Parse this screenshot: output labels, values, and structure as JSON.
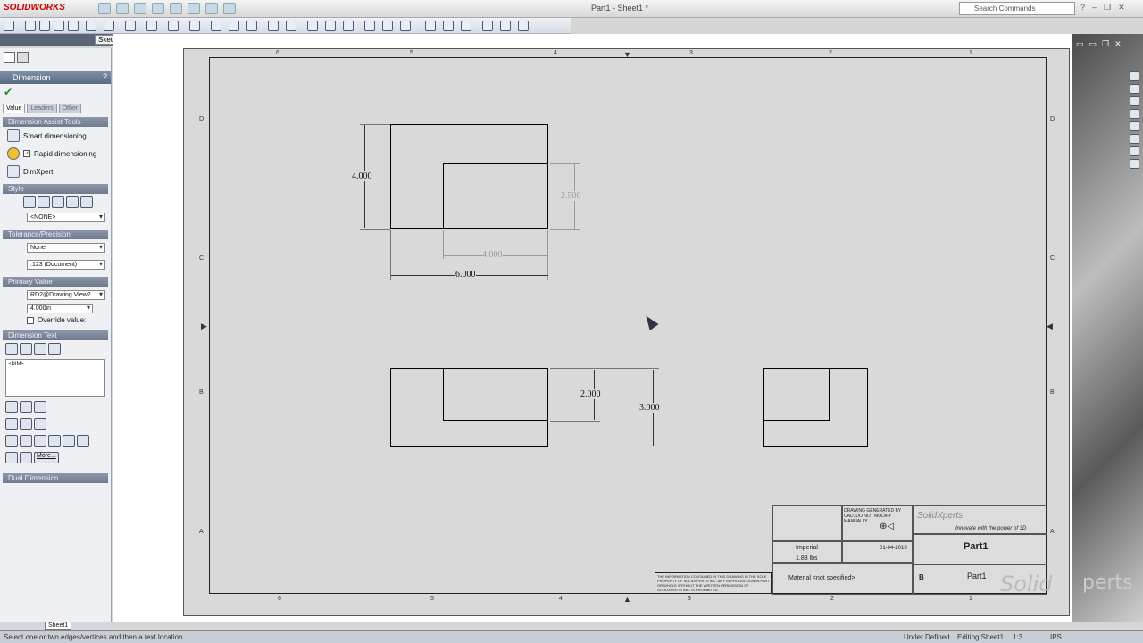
{
  "app": {
    "logo": "SOLIDWORKS",
    "doc_title": "Part1 - Sheet1 *"
  },
  "search": {
    "placeholder": "Search Commands"
  },
  "tabs": {
    "sketch": "Sketch"
  },
  "panel": {
    "title": "Dimension",
    "prop_tabs": [
      "Value",
      "Leaders",
      "Other"
    ],
    "dim_assist_head": "Dimension Assist Tools",
    "smart_dim": "Smart dimensioning",
    "rapid_dim": "Rapid dimensioning",
    "dimxpert": "DimXpert",
    "style_head": "Style",
    "style_value": "<NONE>",
    "tol_head": "Tolerance/Precision",
    "tol_none": "None",
    "tol_doc": ".123 (Document)",
    "primary_head": "Primary Value",
    "primary_ref": "RD2@Drawing View2",
    "primary_val": "4.000in",
    "override": "Override value:",
    "dimtext_head": "Dimension Text",
    "dimtext_content": "<DIM>",
    "more": "More...",
    "dual_head": "Dual Dimension"
  },
  "drawing": {
    "dims": {
      "d_top_height": "4.000",
      "d_right_h": "2.500",
      "d_inner_w": "4.000",
      "d_overall_w": "6.000",
      "d_front_small": "2.000",
      "d_front_overall": "3.000"
    },
    "zones_top": [
      "6",
      "5",
      "4",
      "3",
      "2",
      "1"
    ],
    "zones_bottom": [
      "6",
      "5",
      "4",
      "3",
      "2",
      "1"
    ],
    "zones_left": [
      "D",
      "C",
      "B",
      "A"
    ],
    "zones_right": [
      "D",
      "C",
      "B",
      "A"
    ]
  },
  "title_block": {
    "part_name": "Part1",
    "part_number": "Part1",
    "units": "Imperial",
    "weight": "1.88 lbs",
    "material": "Material <not specified>",
    "date": "01-04-2013",
    "size": "B",
    "tagline": "Innovate with the power of 3D",
    "company": "SolidXperts",
    "generated": "DRAWING GENERATED BY CAD, DO NOT MODIFY MANUALLY",
    "proprietary": "THE INFORMATION CONTAINED IN THIS DRAWING IS THE SOLE PROPERTY OF SOLIDXPERTS INC. ANY REPRODUCTION IN PART OR WHOLE WITHOUT THE WRITTEN PERMISSION OF SOLIDXPERTS INC. IS PROHIBITED."
  },
  "status": {
    "hint": "Select one or two edges/vertices and then a text location.",
    "state": "Under Defined",
    "editing": "Editing Sheet1",
    "scale": "1:3",
    "units": "IPS"
  },
  "sheet_tab": "Sheet1",
  "watermark": {
    "left": "Solid",
    "right": "perts"
  },
  "colors": {
    "accent": "#c00000",
    "panel_head": "#6b7b94"
  }
}
